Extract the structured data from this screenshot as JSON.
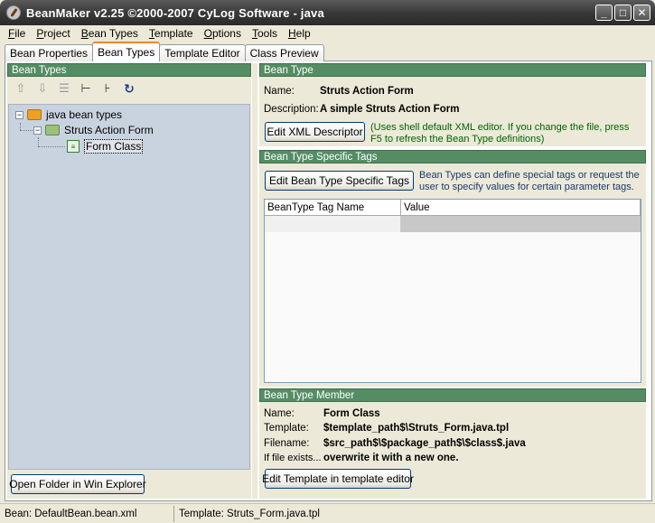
{
  "window": {
    "title": "BeanMaker v2.25 ©2000-2007 CyLog Software - java",
    "buttons": {
      "minimize": "_",
      "maximize": "□",
      "close": "✕"
    }
  },
  "menu": [
    "File",
    "Project",
    "Bean Types",
    "Template",
    "Options",
    "Tools",
    "Help"
  ],
  "tabs": [
    {
      "label": "Bean Properties",
      "active": false
    },
    {
      "label": "Bean Types",
      "active": true
    },
    {
      "label": "Template Editor",
      "active": false
    },
    {
      "label": "Class Preview",
      "active": false
    }
  ],
  "left_panel": {
    "header": "Bean Types",
    "toolbar_icons": [
      "up-arrow-icon",
      "down-arrow-icon",
      "list-icon",
      "tree-expand-icon",
      "tree-collapse-icon",
      "refresh-icon"
    ],
    "tree": {
      "root": {
        "label": "java bean types",
        "expander": "−"
      },
      "child": {
        "label": "Struts Action Form",
        "expander": "−"
      },
      "leaf": {
        "label": "Form Class",
        "selected": true
      }
    },
    "open_folder_button": "Open Folder in Win Explorer"
  },
  "bean_type": {
    "header": "Bean Type",
    "name_label": "Name:",
    "name_value": "Struts Action Form",
    "description_label": "Description:",
    "description_value": "A simple Struts Action Form",
    "edit_xml_button": "Edit XML Descriptor",
    "note": "(Uses shell default XML editor. If you change the file, press F5 to refresh the Bean Type definitions)"
  },
  "specific_tags": {
    "header": "Bean Type Specific Tags",
    "edit_button": "Edit Bean Type Specific Tags",
    "note": "Bean Types can define special tags or request the user to specify values for certain parameter tags.",
    "columns": [
      "BeanType Tag Name",
      "Value"
    ]
  },
  "member": {
    "header": "Bean Type Member",
    "name_label": "Name:",
    "name_value": "Form Class",
    "template_label": "Template:",
    "template_value": "$template_path$\\Struts_Form.java.tpl",
    "filename_label": "Filename:",
    "filename_value": "$src_path$\\$package_path$\\$class$.java",
    "exists_label": "If file exists...",
    "exists_value": "overwrite it with a new one.",
    "edit_template_button": "Edit Template in template editor"
  },
  "status": {
    "bean": "Bean: DefaultBean.bean.xml",
    "template": "Template: Struts_Form.java.tpl"
  },
  "colors": {
    "section_header": "#548d64",
    "tab_highlight": "#e68b2c",
    "note_green": "#006400",
    "tree_bg": "#c9d3e0"
  }
}
